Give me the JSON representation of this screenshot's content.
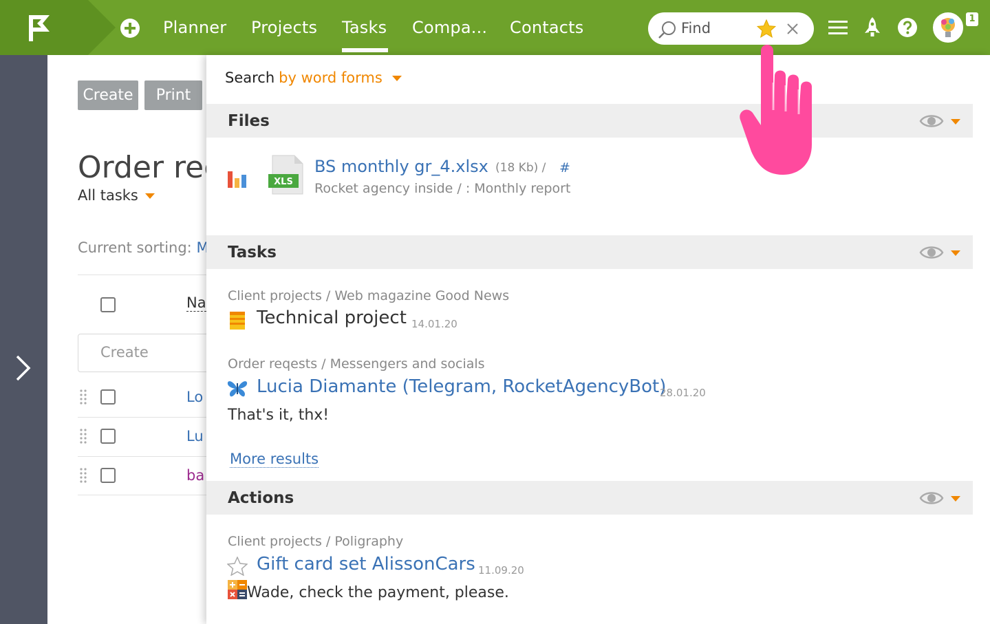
{
  "topbar": {
    "nav": [
      "Planner",
      "Projects",
      "Tasks",
      "Compa...",
      "Contacts"
    ],
    "active_nav": "Tasks",
    "find_placeholder": "Find",
    "notifications_count": "1",
    "bar_color": "#6ea22b"
  },
  "background_page": {
    "create_button": "Create",
    "print_button": "Print",
    "title": "Order rec",
    "filter": "All tasks",
    "sorting_label": "Current sorting:",
    "sorting_value": "M",
    "name_column": "Na",
    "create_placeholder": "Create",
    "rows": [
      {
        "label": "Lo",
        "color": "#3a72b5"
      },
      {
        "label": "Lu",
        "color": "#3a72b5"
      },
      {
        "label": "ba",
        "color": "#9c2a8e"
      }
    ]
  },
  "search": {
    "label": "Search",
    "mode": "by word forms",
    "sections": {
      "files": {
        "title": "Files",
        "item": {
          "name": "BS monthly gr_4.xlsx",
          "size": "(18 Kb) /",
          "hash": "#",
          "path": "Rocket agency inside / : Monthly report",
          "badge": "XLS"
        }
      },
      "tasks": {
        "title": "Tasks",
        "items": [
          {
            "breadcrumb": "Client projects / Web magazine Good News",
            "title": "Technical project",
            "date": "14.01.20",
            "icon": "document-icon"
          },
          {
            "breadcrumb": "Order reqests / Messengers and socials",
            "title": "Lucia Diamante (Telegram, RocketAgencyBot)",
            "date": "28.01.20",
            "text": "That's it, thx!",
            "icon": "butterfly-icon"
          }
        ],
        "more": "More results"
      },
      "actions": {
        "title": "Actions",
        "items": [
          {
            "breadcrumb": "Client projects / Poligraphy",
            "title": "Gift card set AlissonCars",
            "date": "11.09.20",
            "text": "Wade, check the payment, please.",
            "icon": "star-outline-icon"
          }
        ]
      }
    }
  }
}
